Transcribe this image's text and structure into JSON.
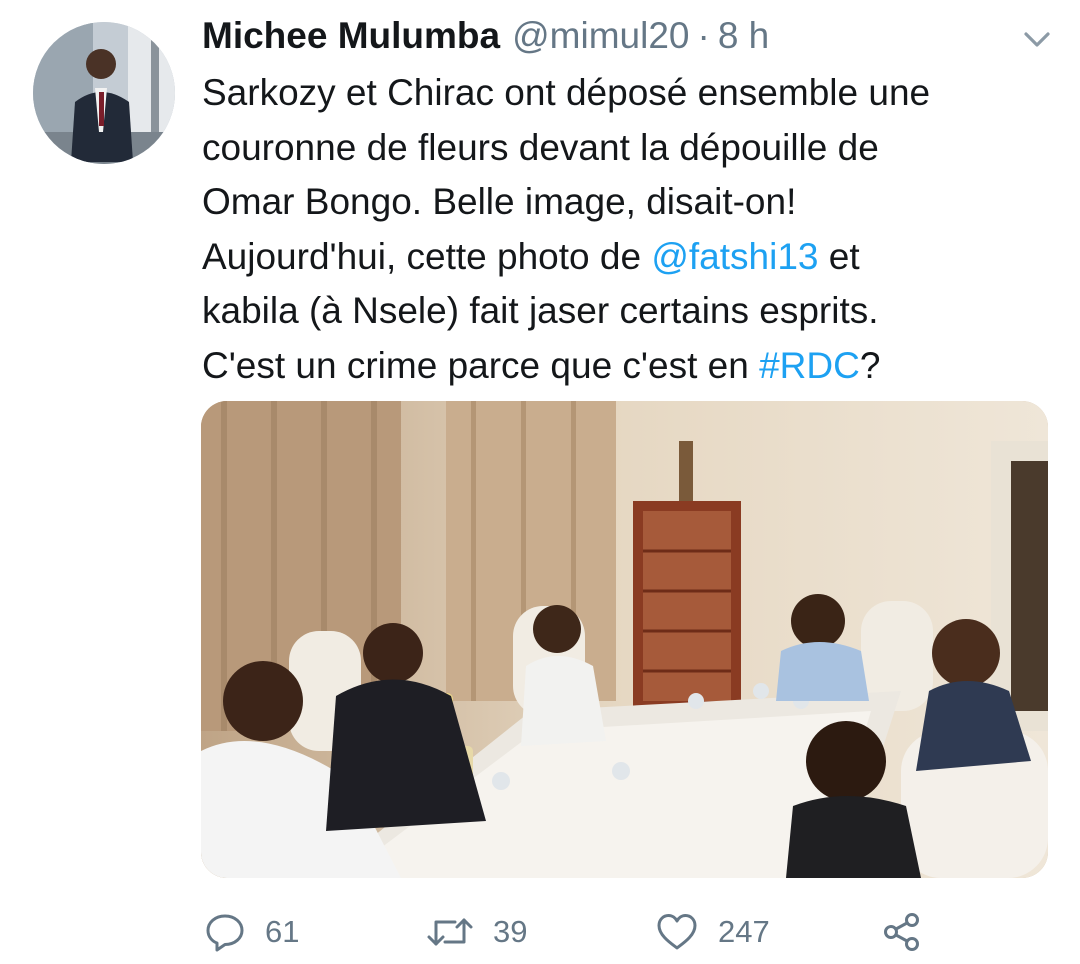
{
  "tweet": {
    "display_name": "Michee Mulumba",
    "handle": "@mimul20",
    "separator": "·",
    "time": "8 h",
    "text": {
      "l1": "Sarkozy et Chirac ont déposé ensemble une",
      "l2": "couronne de fleurs devant la dépouille de",
      "l3": "Omar Bongo. Belle image, disait-on!",
      "l4a": "Aujourd'hui, cette photo de ",
      "mention": "@fatshi13",
      "l4b": " et",
      "l5": "kabila (à Nsele) fait jaser certains esprits.",
      "l6a": "C'est un crime parce que c'est en ",
      "hashtag": "#RDC",
      "l6b": "?"
    }
  },
  "actions": {
    "replies": "61",
    "retweets": "39",
    "likes": "247"
  },
  "icons": {
    "caret": "chevron-down-icon",
    "reply": "reply-icon",
    "retweet": "retweet-icon",
    "like": "heart-icon",
    "share": "share-icon"
  },
  "colors": {
    "link": "#1da1f2",
    "secondary_text": "#657786",
    "primary_text": "#14171a"
  }
}
